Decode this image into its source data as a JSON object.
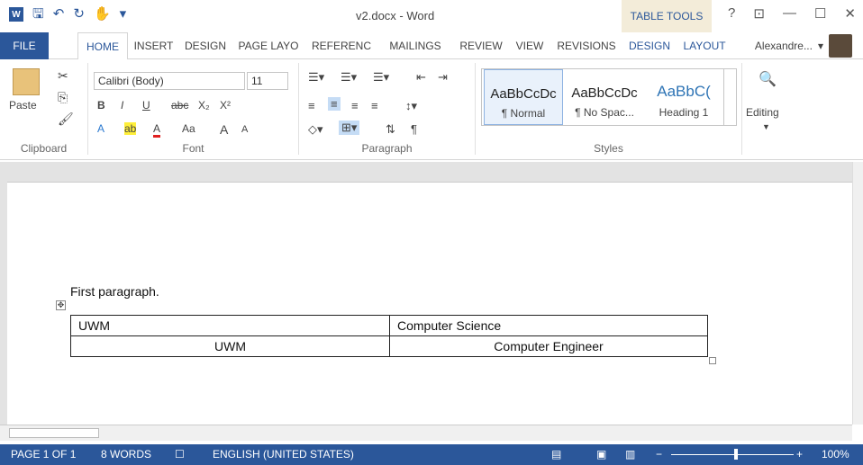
{
  "titlebar": {
    "doc_title": "v2.docx - Word",
    "contextual_label": "TABLE TOOLS",
    "help": "?",
    "restore": "⊡",
    "minimize": "—",
    "maximize": "☐",
    "close": "✕",
    "save_glyph": "🖫",
    "undo_glyph": "↶",
    "redo_glyph": "↻",
    "touch_glyph": "✋",
    "customize_glyph": "▾"
  },
  "tabs": [
    "FILE",
    "HOME",
    "INSERT",
    "DESIGN",
    "PAGE LAYO",
    "REFERENC",
    "MAILINGS",
    "REVIEW",
    "VIEW",
    "REVISIONS",
    "DESIGN",
    "LAYOUT"
  ],
  "user": {
    "name": "Alexandre...",
    "dropdown": "▾"
  },
  "ribbon": {
    "clipboard": {
      "label": "Clipboard",
      "paste": "Paste"
    },
    "font": {
      "label": "Font",
      "name": "Calibri (Body)",
      "size": "11",
      "row2": [
        "B",
        "I",
        "U",
        "abc",
        "X₂",
        "X²"
      ],
      "row3": [
        "A",
        "ab",
        "A",
        "Aa",
        "A",
        "A"
      ]
    },
    "paragraph": {
      "label": "Paragraph"
    },
    "styles": {
      "label": "Styles",
      "items": [
        {
          "preview": "AaBbCcDc",
          "name": "¶ Normal"
        },
        {
          "preview": "AaBbCcDc",
          "name": "¶ No Spac..."
        },
        {
          "preview": "AaBbC(",
          "name": "Heading 1"
        }
      ]
    },
    "editing": {
      "label": "Editing"
    }
  },
  "document": {
    "paragraph": "First paragraph.",
    "table": [
      [
        "UWM",
        "Computer Science"
      ],
      [
        "UWM",
        "Computer Engineer"
      ]
    ]
  },
  "statusbar": {
    "page": "PAGE 1 OF 1",
    "words": "8 WORDS",
    "language": "ENGLISH (UNITED STATES)",
    "zoom": "100%"
  },
  "colors": {
    "accent": "#2b579a",
    "contextual": "#f3ecd9"
  }
}
